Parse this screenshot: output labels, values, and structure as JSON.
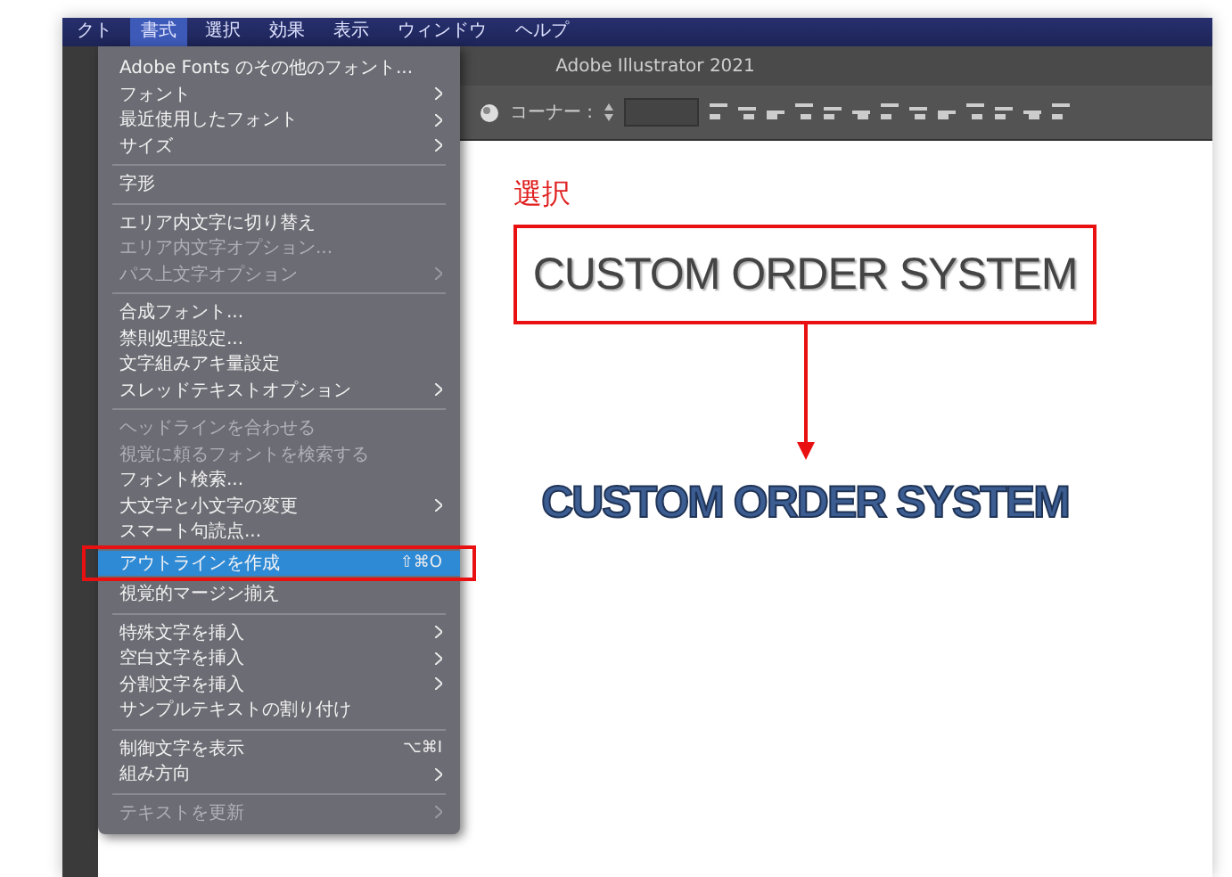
{
  "menubar": {
    "items": [
      {
        "label": "クト",
        "selected": false
      },
      {
        "label": "書式",
        "selected": true
      },
      {
        "label": "選択",
        "selected": false
      },
      {
        "label": "効果",
        "selected": false
      },
      {
        "label": "表示",
        "selected": false
      },
      {
        "label": "ウィンドウ",
        "selected": false
      },
      {
        "label": "ヘルプ",
        "selected": false
      }
    ]
  },
  "window": {
    "title": "Adobe Illustrator 2021"
  },
  "control_bar": {
    "corner_label": "コーナー :"
  },
  "menu": {
    "items": [
      {
        "kind": "item",
        "label": "Adobe Fonts のその他のフォント...",
        "disabled": false,
        "submenu": false,
        "selected": false,
        "marked": false
      },
      {
        "kind": "item",
        "label": "フォント",
        "disabled": false,
        "submenu": true,
        "selected": false,
        "marked": false
      },
      {
        "kind": "item",
        "label": "最近使用したフォント",
        "disabled": false,
        "submenu": true,
        "selected": false,
        "marked": false
      },
      {
        "kind": "item",
        "label": "サイズ",
        "disabled": false,
        "submenu": true,
        "selected": false,
        "marked": false
      },
      {
        "kind": "separator"
      },
      {
        "kind": "item",
        "label": "字形",
        "disabled": false,
        "submenu": false,
        "selected": false,
        "marked": false
      },
      {
        "kind": "separator"
      },
      {
        "kind": "item",
        "label": "エリア内文字に切り替え",
        "disabled": false,
        "submenu": false,
        "selected": false,
        "marked": false
      },
      {
        "kind": "item",
        "label": "エリア内文字オプション...",
        "disabled": true,
        "submenu": false,
        "selected": false,
        "marked": false
      },
      {
        "kind": "item",
        "label": "パス上文字オプション",
        "disabled": true,
        "submenu": true,
        "selected": false,
        "marked": false
      },
      {
        "kind": "separator"
      },
      {
        "kind": "item",
        "label": "合成フォント...",
        "disabled": false,
        "submenu": false,
        "selected": false,
        "marked": false
      },
      {
        "kind": "item",
        "label": "禁則処理設定...",
        "disabled": false,
        "submenu": false,
        "selected": false,
        "marked": false
      },
      {
        "kind": "item",
        "label": "文字組みアキ量設定",
        "disabled": false,
        "submenu": false,
        "selected": false,
        "marked": false
      },
      {
        "kind": "item",
        "label": "スレッドテキストオプション",
        "disabled": false,
        "submenu": true,
        "selected": false,
        "marked": false
      },
      {
        "kind": "separator"
      },
      {
        "kind": "item",
        "label": "ヘッドラインを合わせる",
        "disabled": true,
        "submenu": false,
        "selected": false,
        "marked": false
      },
      {
        "kind": "item",
        "label": "視覚に頼るフォントを検索する",
        "disabled": true,
        "submenu": false,
        "selected": false,
        "marked": false
      },
      {
        "kind": "item",
        "label": "フォント検索...",
        "disabled": false,
        "submenu": false,
        "selected": false,
        "marked": false
      },
      {
        "kind": "item",
        "label": "大文字と小文字の変更",
        "disabled": false,
        "submenu": true,
        "selected": false,
        "marked": false
      },
      {
        "kind": "item",
        "label": "スマート句読点...",
        "disabled": false,
        "submenu": false,
        "selected": false,
        "marked": false
      },
      {
        "kind": "item",
        "label": "アウトラインを作成",
        "shortcut": "⇧⌘O",
        "disabled": false,
        "submenu": false,
        "selected": true,
        "marked": true
      },
      {
        "kind": "item",
        "label": "視覚的マージン揃え",
        "disabled": false,
        "submenu": false,
        "selected": false,
        "marked": false
      },
      {
        "kind": "separator"
      },
      {
        "kind": "item",
        "label": "特殊文字を挿入",
        "disabled": false,
        "submenu": true,
        "selected": false,
        "marked": false
      },
      {
        "kind": "item",
        "label": "空白文字を挿入",
        "disabled": false,
        "submenu": true,
        "selected": false,
        "marked": false
      },
      {
        "kind": "item",
        "label": "分割文字を挿入",
        "disabled": false,
        "submenu": true,
        "selected": false,
        "marked": false
      },
      {
        "kind": "item",
        "label": "サンプルテキストの割り付け",
        "disabled": false,
        "submenu": false,
        "selected": false,
        "marked": false
      },
      {
        "kind": "separator"
      },
      {
        "kind": "item",
        "label": "制御文字を表示",
        "shortcut": "⌥⌘I",
        "disabled": false,
        "submenu": false,
        "selected": false,
        "marked": false
      },
      {
        "kind": "item",
        "label": "組み方向",
        "disabled": false,
        "submenu": true,
        "selected": false,
        "marked": false
      },
      {
        "kind": "separator"
      },
      {
        "kind": "item",
        "label": "テキストを更新",
        "disabled": true,
        "submenu": true,
        "selected": false,
        "marked": false
      }
    ]
  },
  "canvas": {
    "annotation": "選択",
    "original_text": "CUSTOM ORDER SYSTEM",
    "outlined_text": "CUSTOM ORDER SYSTEM"
  }
}
